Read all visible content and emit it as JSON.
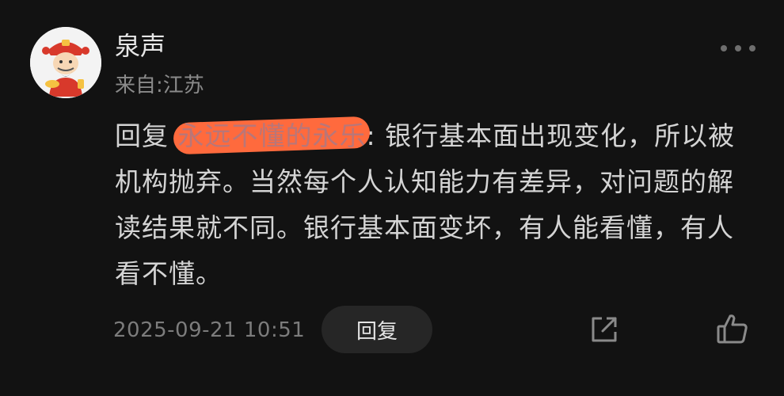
{
  "user": {
    "name": "泉声",
    "location": "来自:江苏",
    "avatar_icon": "fortune-god-avatar"
  },
  "comment": {
    "reply_prefix": "回复 ",
    "mention": "永远不懂的永乐",
    "colon": ": ",
    "body": "银行基本面出现变化，所以被机构抛弃。当然每个人认知能力有差异，对问题的解读结果就不同。银行基本面变坏，有人能看懂，有人看不懂。"
  },
  "footer": {
    "timestamp": "2025-09-21 10:51",
    "reply_label": "回复",
    "share_icon": "share-icon",
    "like_icon": "thumbs-up-icon"
  },
  "colors": {
    "background": "#121212",
    "mention": "#3a8ee6",
    "redaction": "#ff6a3d"
  }
}
